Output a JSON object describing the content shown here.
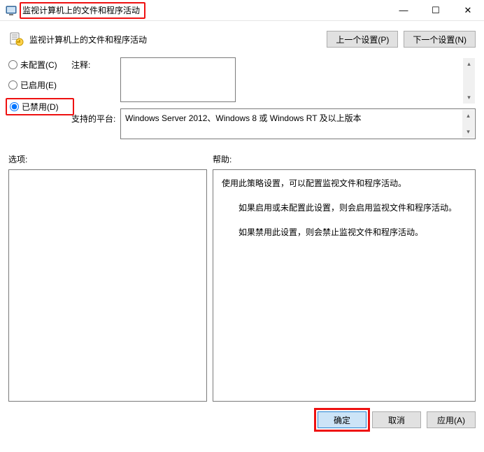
{
  "window": {
    "title": "监视计算机上的文件和程序活动",
    "minimize_glyph": "—",
    "maximize_glyph": "☐",
    "close_glyph": "✕"
  },
  "subheader": {
    "title": "监视计算机上的文件和程序活动",
    "prev_btn": "上一个设置(P)",
    "next_btn": "下一个设置(N)"
  },
  "radios": {
    "not_configured": "未配置(C)",
    "enabled": "已启用(E)",
    "disabled": "已禁用(D)",
    "selected": "disabled"
  },
  "comment": {
    "label": "注释:",
    "value": ""
  },
  "platform": {
    "label": "支持的平台:",
    "value": "Windows Server 2012、Windows 8 或 Windows RT 及以上版本"
  },
  "labels": {
    "options": "选项:",
    "help": "帮助:"
  },
  "help": {
    "p1": "使用此策略设置，可以配置监视文件和程序活动。",
    "p2": "如果启用或未配置此设置，则会启用监视文件和程序活动。",
    "p3": "如果禁用此设置，则会禁止监视文件和程序活动。"
  },
  "buttons": {
    "ok": "确定",
    "cancel": "取消",
    "apply": "应用(A)"
  },
  "scroll": {
    "up_glyph": "▴",
    "down_glyph": "▾"
  }
}
